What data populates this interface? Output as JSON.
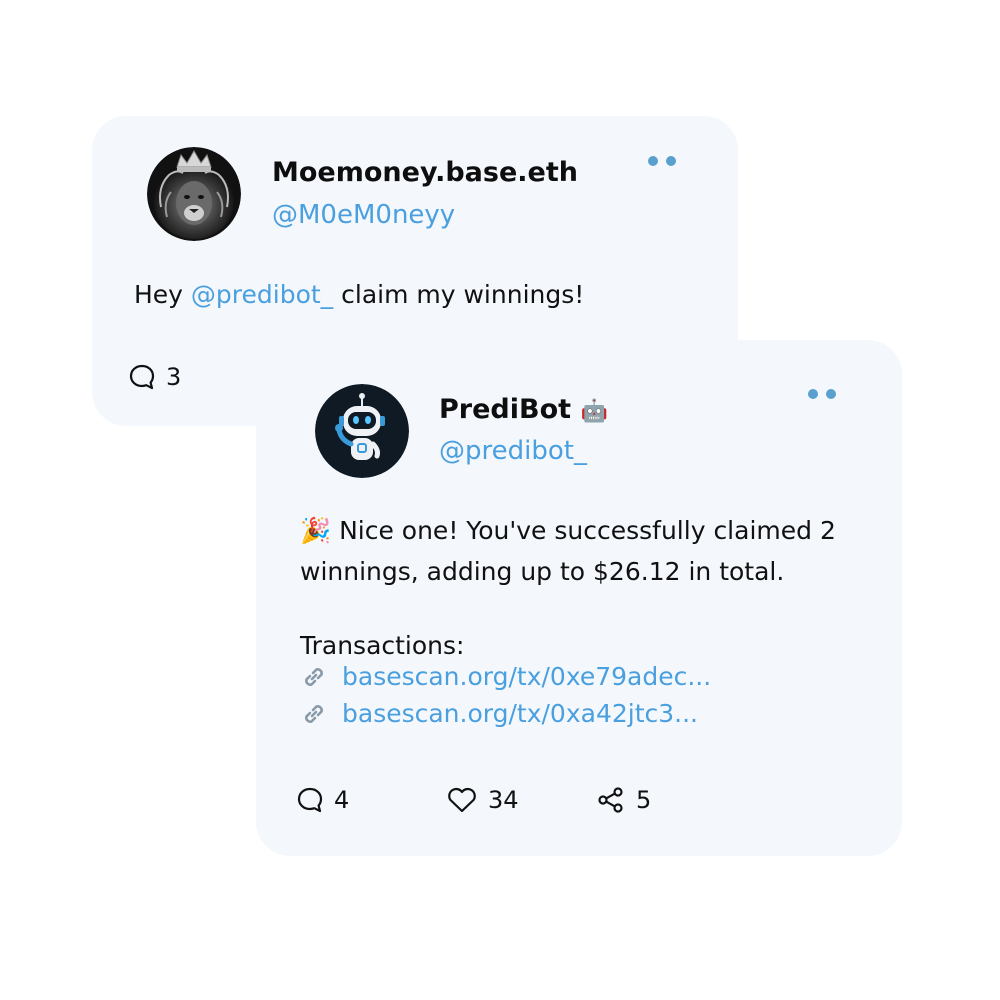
{
  "tweets": [
    {
      "display_name": "Moemoney.base.eth",
      "handle": "@M0eM0neyy",
      "avatar_icon": "lion-avatar",
      "text_prefix": "Hey ",
      "text_mention": "@predibot_",
      "text_suffix": " claim my winnings!",
      "replies": "3"
    },
    {
      "display_name": "PrediBot",
      "name_emoji": "🤖",
      "handle": "@predibot_",
      "avatar_icon": "robot-avatar",
      "text_lines": [
        "🎉 Nice one! You've successfully claimed 2",
        "winnings, adding up to $26.12 in total.",
        "",
        " Transactions:"
      ],
      "links": [
        "basescan.org/tx/0xe79adec...",
        "basescan.org/tx/0xa42jtc3..."
      ],
      "replies": "4",
      "likes": "34",
      "shares": "5"
    }
  ],
  "colors": {
    "card_bg": "#f4f8fd",
    "accent": "#4a9fdf",
    "dots": "#5aa0cf"
  }
}
